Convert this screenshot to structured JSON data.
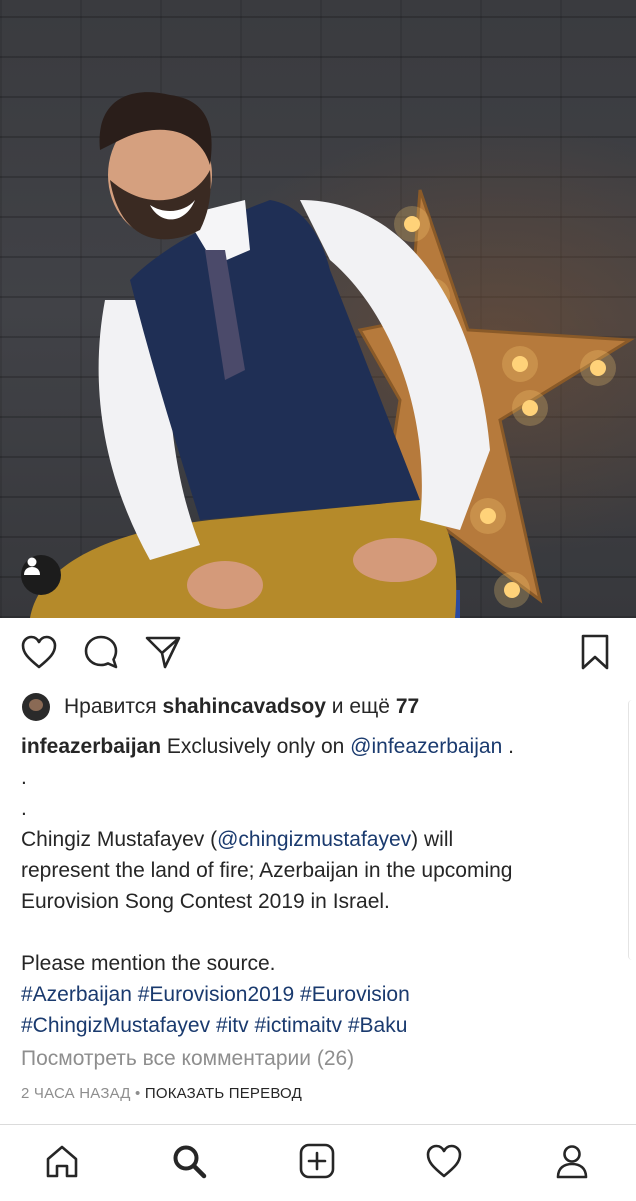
{
  "post": {
    "likes": {
      "prefix": "Нравится",
      "user": "shahincavadsoy",
      "connector": "и ещё",
      "count": "77"
    },
    "caption": {
      "author": "infeazerbaijan",
      "line1_text": "Exclusively only on",
      "line1_mention": "@infeazerbaijan",
      "line1_end": ".",
      "dot1": ".",
      "dot2": ".",
      "para_start": "Chingiz Mustafayev (",
      "para_mention": "@chingizmustafayev",
      "para_line1_end": ") will",
      "para_line2": "represent the land of fire; Azerbaijan in the upcoming",
      "para_line3": "Eurovision Song Contest 2019 in Israel.",
      "source_line": "Please mention the source.",
      "hashtags": [
        "#Azerbaijan",
        "#Eurovision2019",
        "#Eurovision",
        "#ChingizMustafayev",
        "#itv",
        "#ictimaitv",
        "#Baku"
      ]
    },
    "view_comments": "Посмотреть все комментарии (26)",
    "time_ago": "2 ЧАСА НАЗАД",
    "separator": "•",
    "translate": "ПОКАЗАТЬ ПЕРЕВОД"
  },
  "icons": {
    "actions": [
      "heart-icon",
      "comment-icon",
      "share-icon",
      "bookmark-icon"
    ],
    "tabs": [
      "home-icon",
      "search-icon",
      "add-icon",
      "activity-icon",
      "profile-icon"
    ],
    "photo_tag": "user-tag-icon"
  },
  "colors": {
    "link": "#1a3a6e",
    "muted": "#8e8e8e",
    "text": "#262626"
  }
}
